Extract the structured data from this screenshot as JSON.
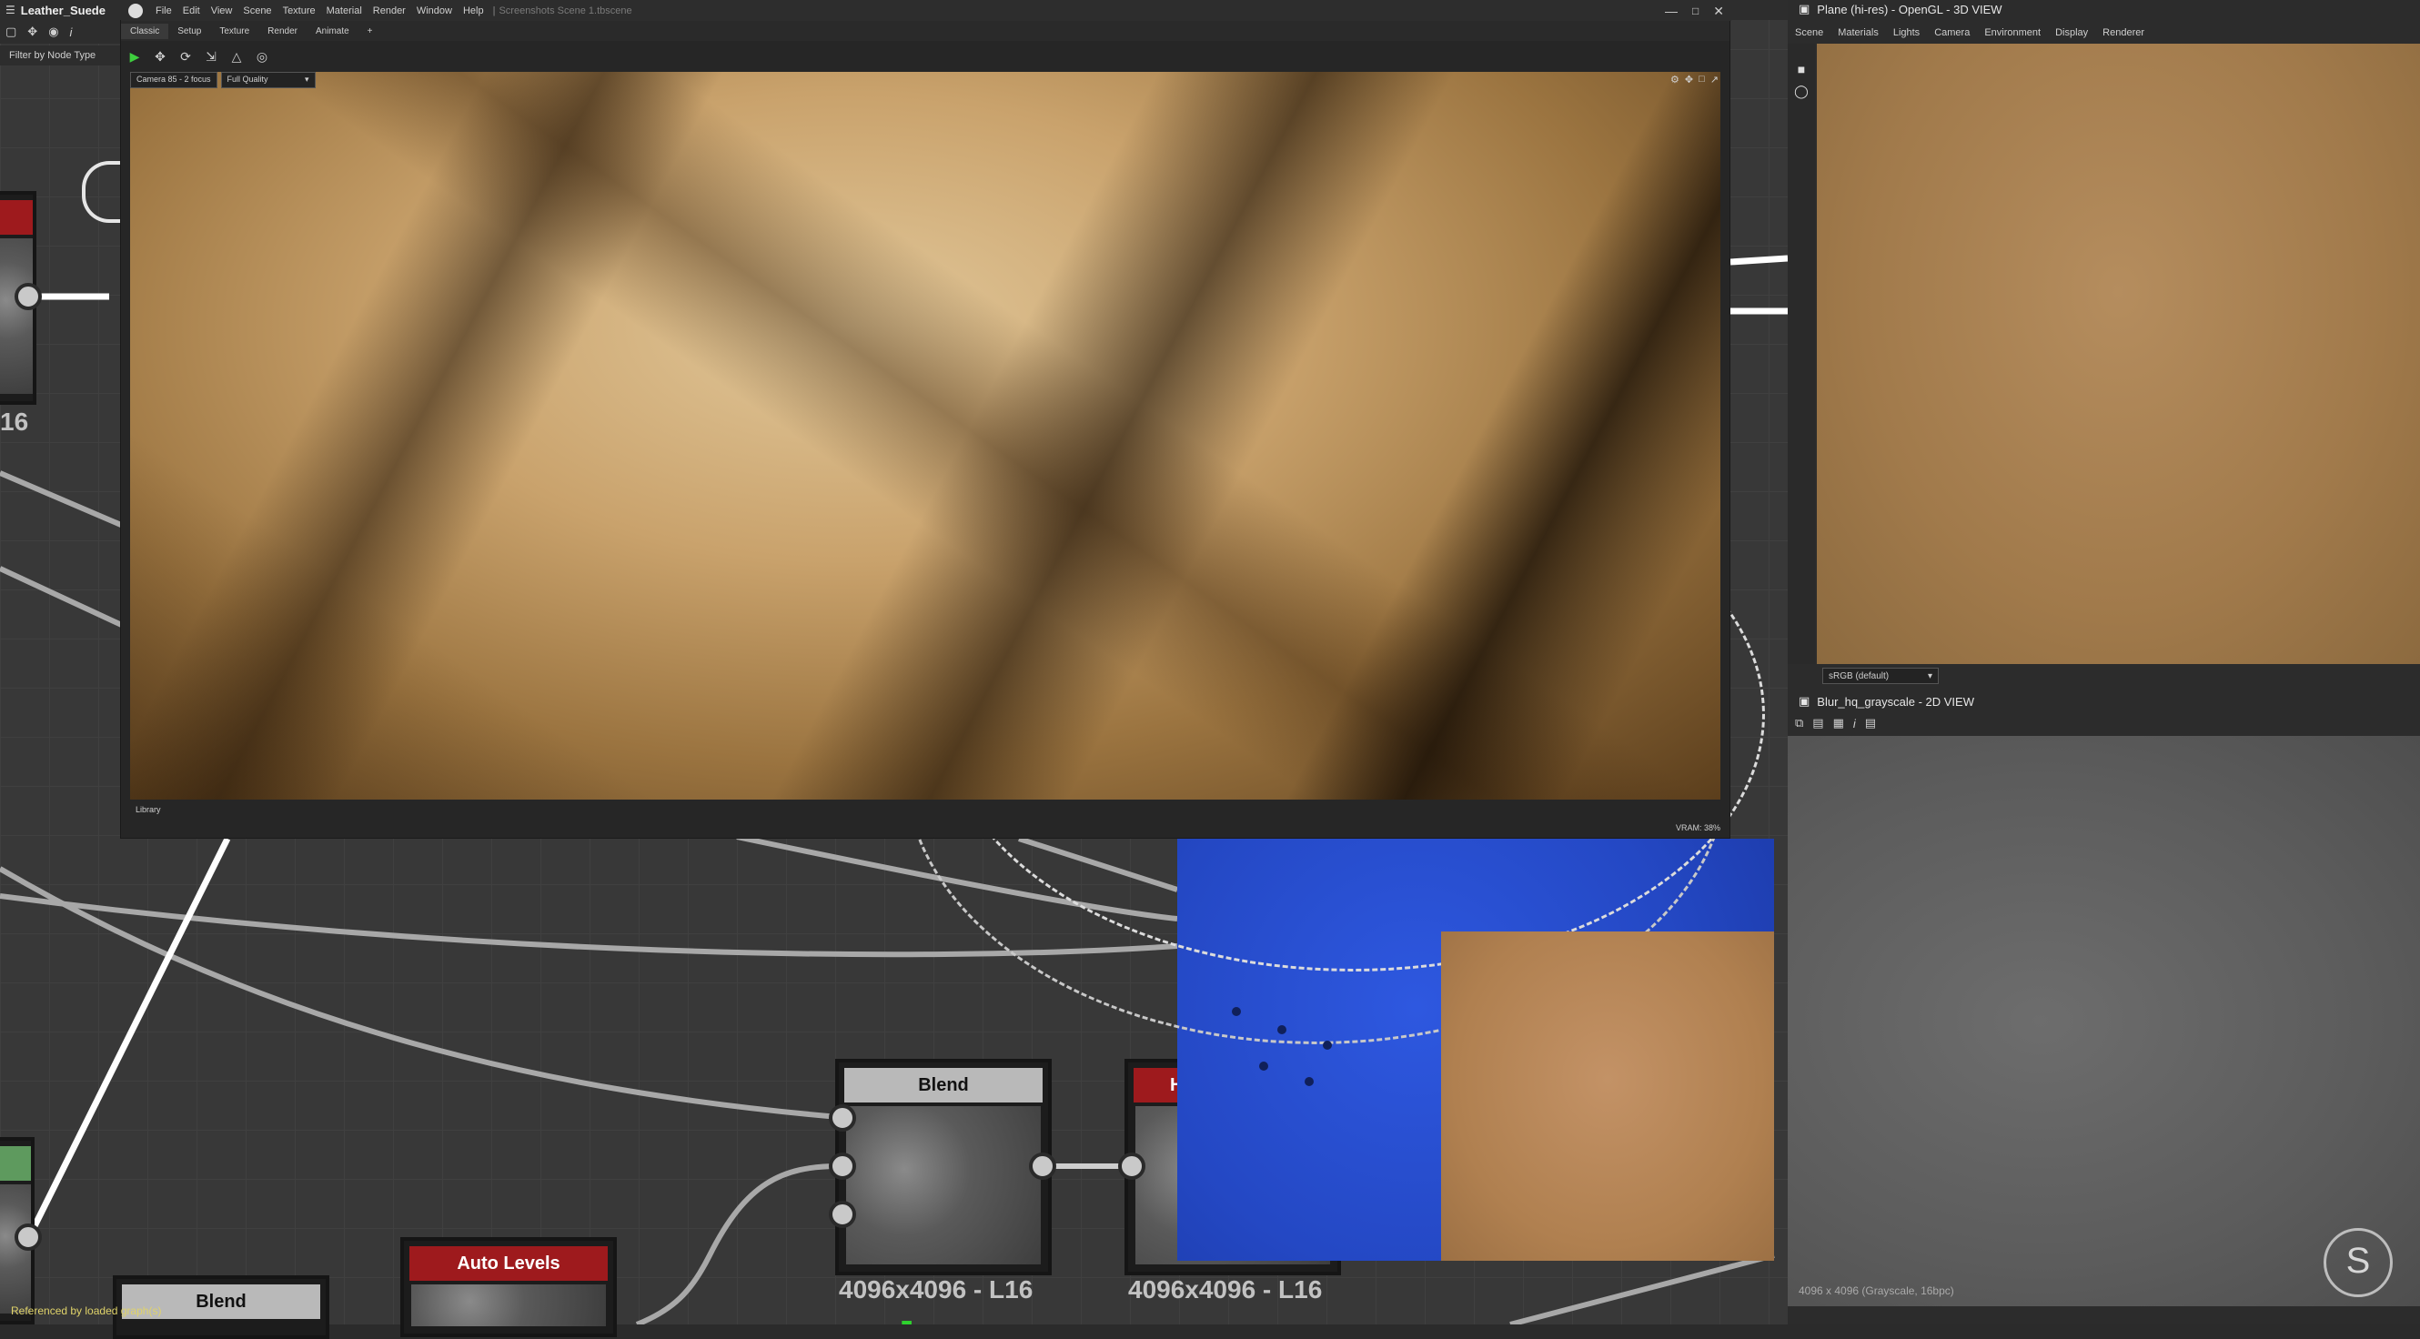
{
  "app": {
    "graph_title": "Leather_Suede",
    "filter_label": "Filter by Node Type",
    "status_text": "Referenced by loaded graph(s)"
  },
  "render_window": {
    "menu": [
      "File",
      "Edit",
      "View",
      "Scene",
      "Texture",
      "Material",
      "Render",
      "Window",
      "Help"
    ],
    "file_title": "Screenshots Scene 1.tbscene",
    "tabs": [
      "Classic",
      "Setup",
      "Texture",
      "Render",
      "Animate",
      "+"
    ],
    "active_tab": "Classic",
    "camera_select": "Camera 85 - 2 focus",
    "quality_select": "Full Quality",
    "library_label": "Library",
    "vram": "VRAM: 38%",
    "colors": {
      "fabric_light": "#e2c89a",
      "fabric_dark": "#5b3e1c"
    }
  },
  "view3d": {
    "title": "Plane (hi-res) - OpenGL - 3D VIEW",
    "menu": [
      "Scene",
      "Materials",
      "Lights",
      "Camera",
      "Environment",
      "Display",
      "Renderer"
    ],
    "colorspace": "sRGB (default)"
  },
  "view2d": {
    "title": "Blur_hq_grayscale - 2D VIEW",
    "info": "4096 x 4096 (Grayscale, 16bpc)"
  },
  "nodes": {
    "blend_main": {
      "title": "Blend",
      "res": "4096x4096 - L16"
    },
    "histogram": {
      "title": "Hi",
      "res": "4096x4096 - L16"
    },
    "auto_levels": {
      "title": "Auto Levels"
    },
    "blend_small": {
      "title": "Blend"
    },
    "left_res": "16"
  }
}
